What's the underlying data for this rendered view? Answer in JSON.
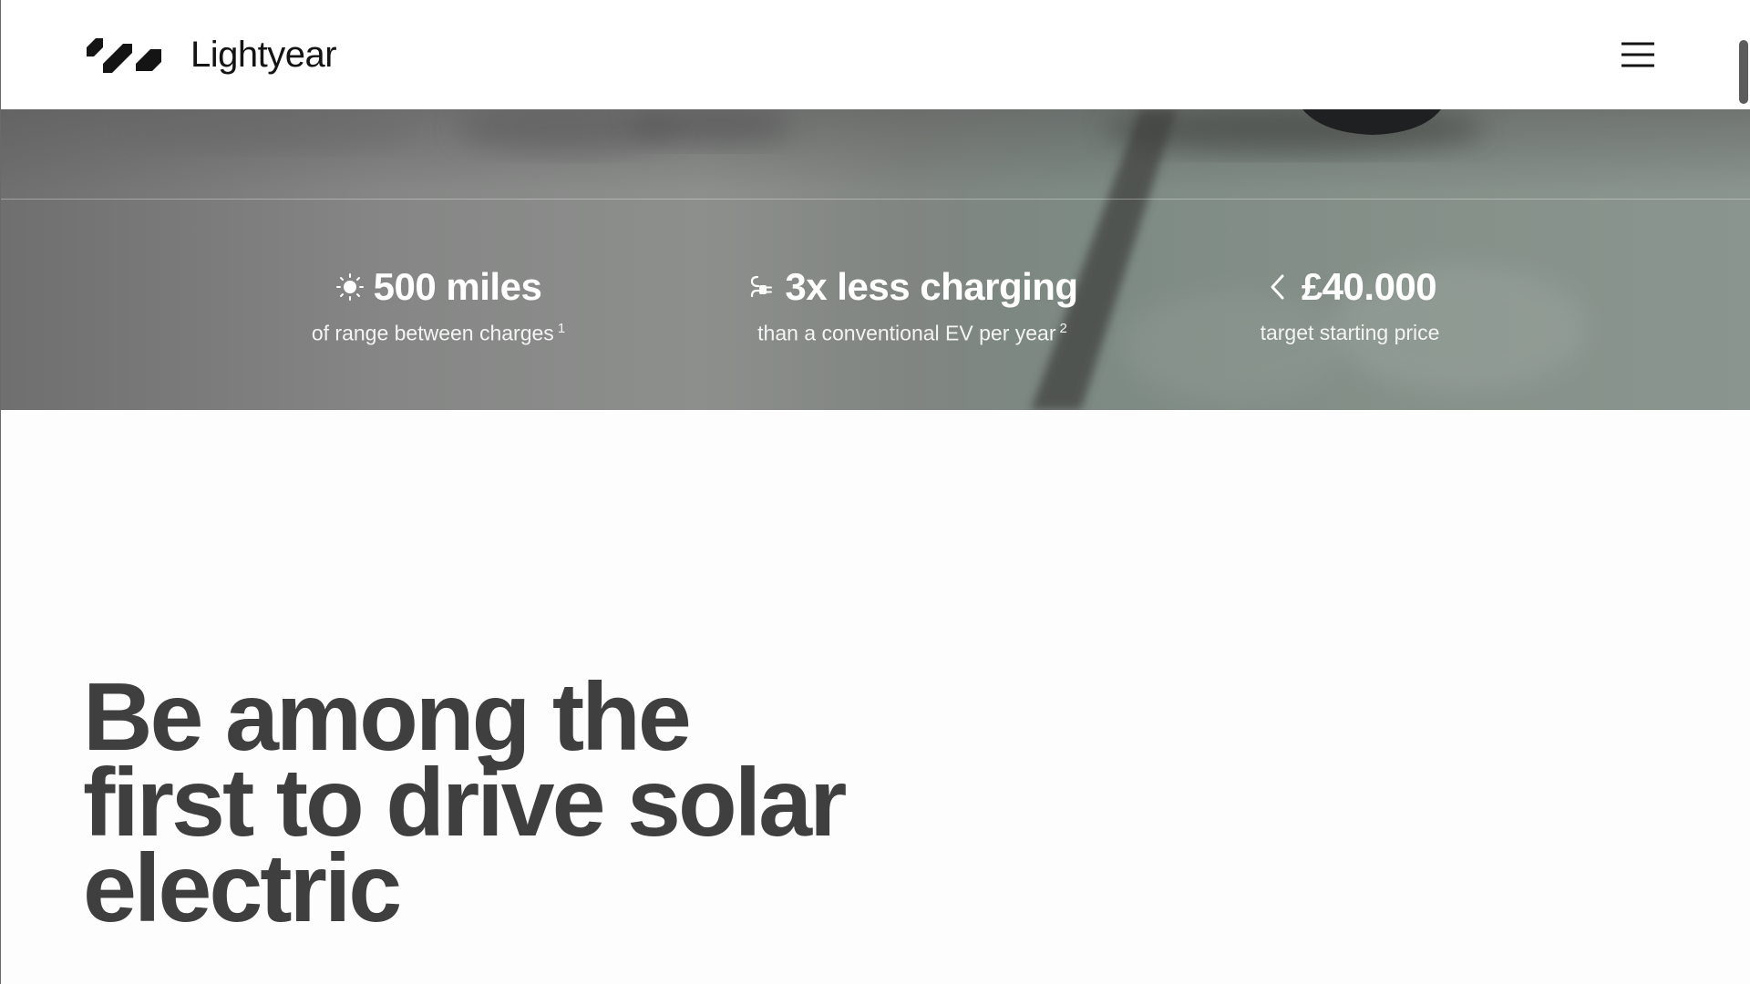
{
  "header": {
    "brand": "Lightyear",
    "logo_icon": "lightyear-logo-icon",
    "menu_icon": "hamburger-menu-icon"
  },
  "stats": [
    {
      "icon": "sun-icon",
      "value": "500 miles",
      "caption": "of range between charges",
      "footnote": "1"
    },
    {
      "icon": "charging-plug-icon",
      "value": "3x less charging",
      "caption": "than a conventional EV per year",
      "footnote": "2"
    },
    {
      "icon": "chevron-left-icon",
      "value": "£40.000",
      "caption": "target starting price",
      "footnote": ""
    }
  ],
  "headline": {
    "line1": "Be among the",
    "line2": "first to drive solar",
    "line3": "electric"
  },
  "colors": {
    "text_dark": "#3f3f3f",
    "header_bg": "#ffffff",
    "stat_text": "#ffffff",
    "hero_tone": "#7f8a84"
  }
}
